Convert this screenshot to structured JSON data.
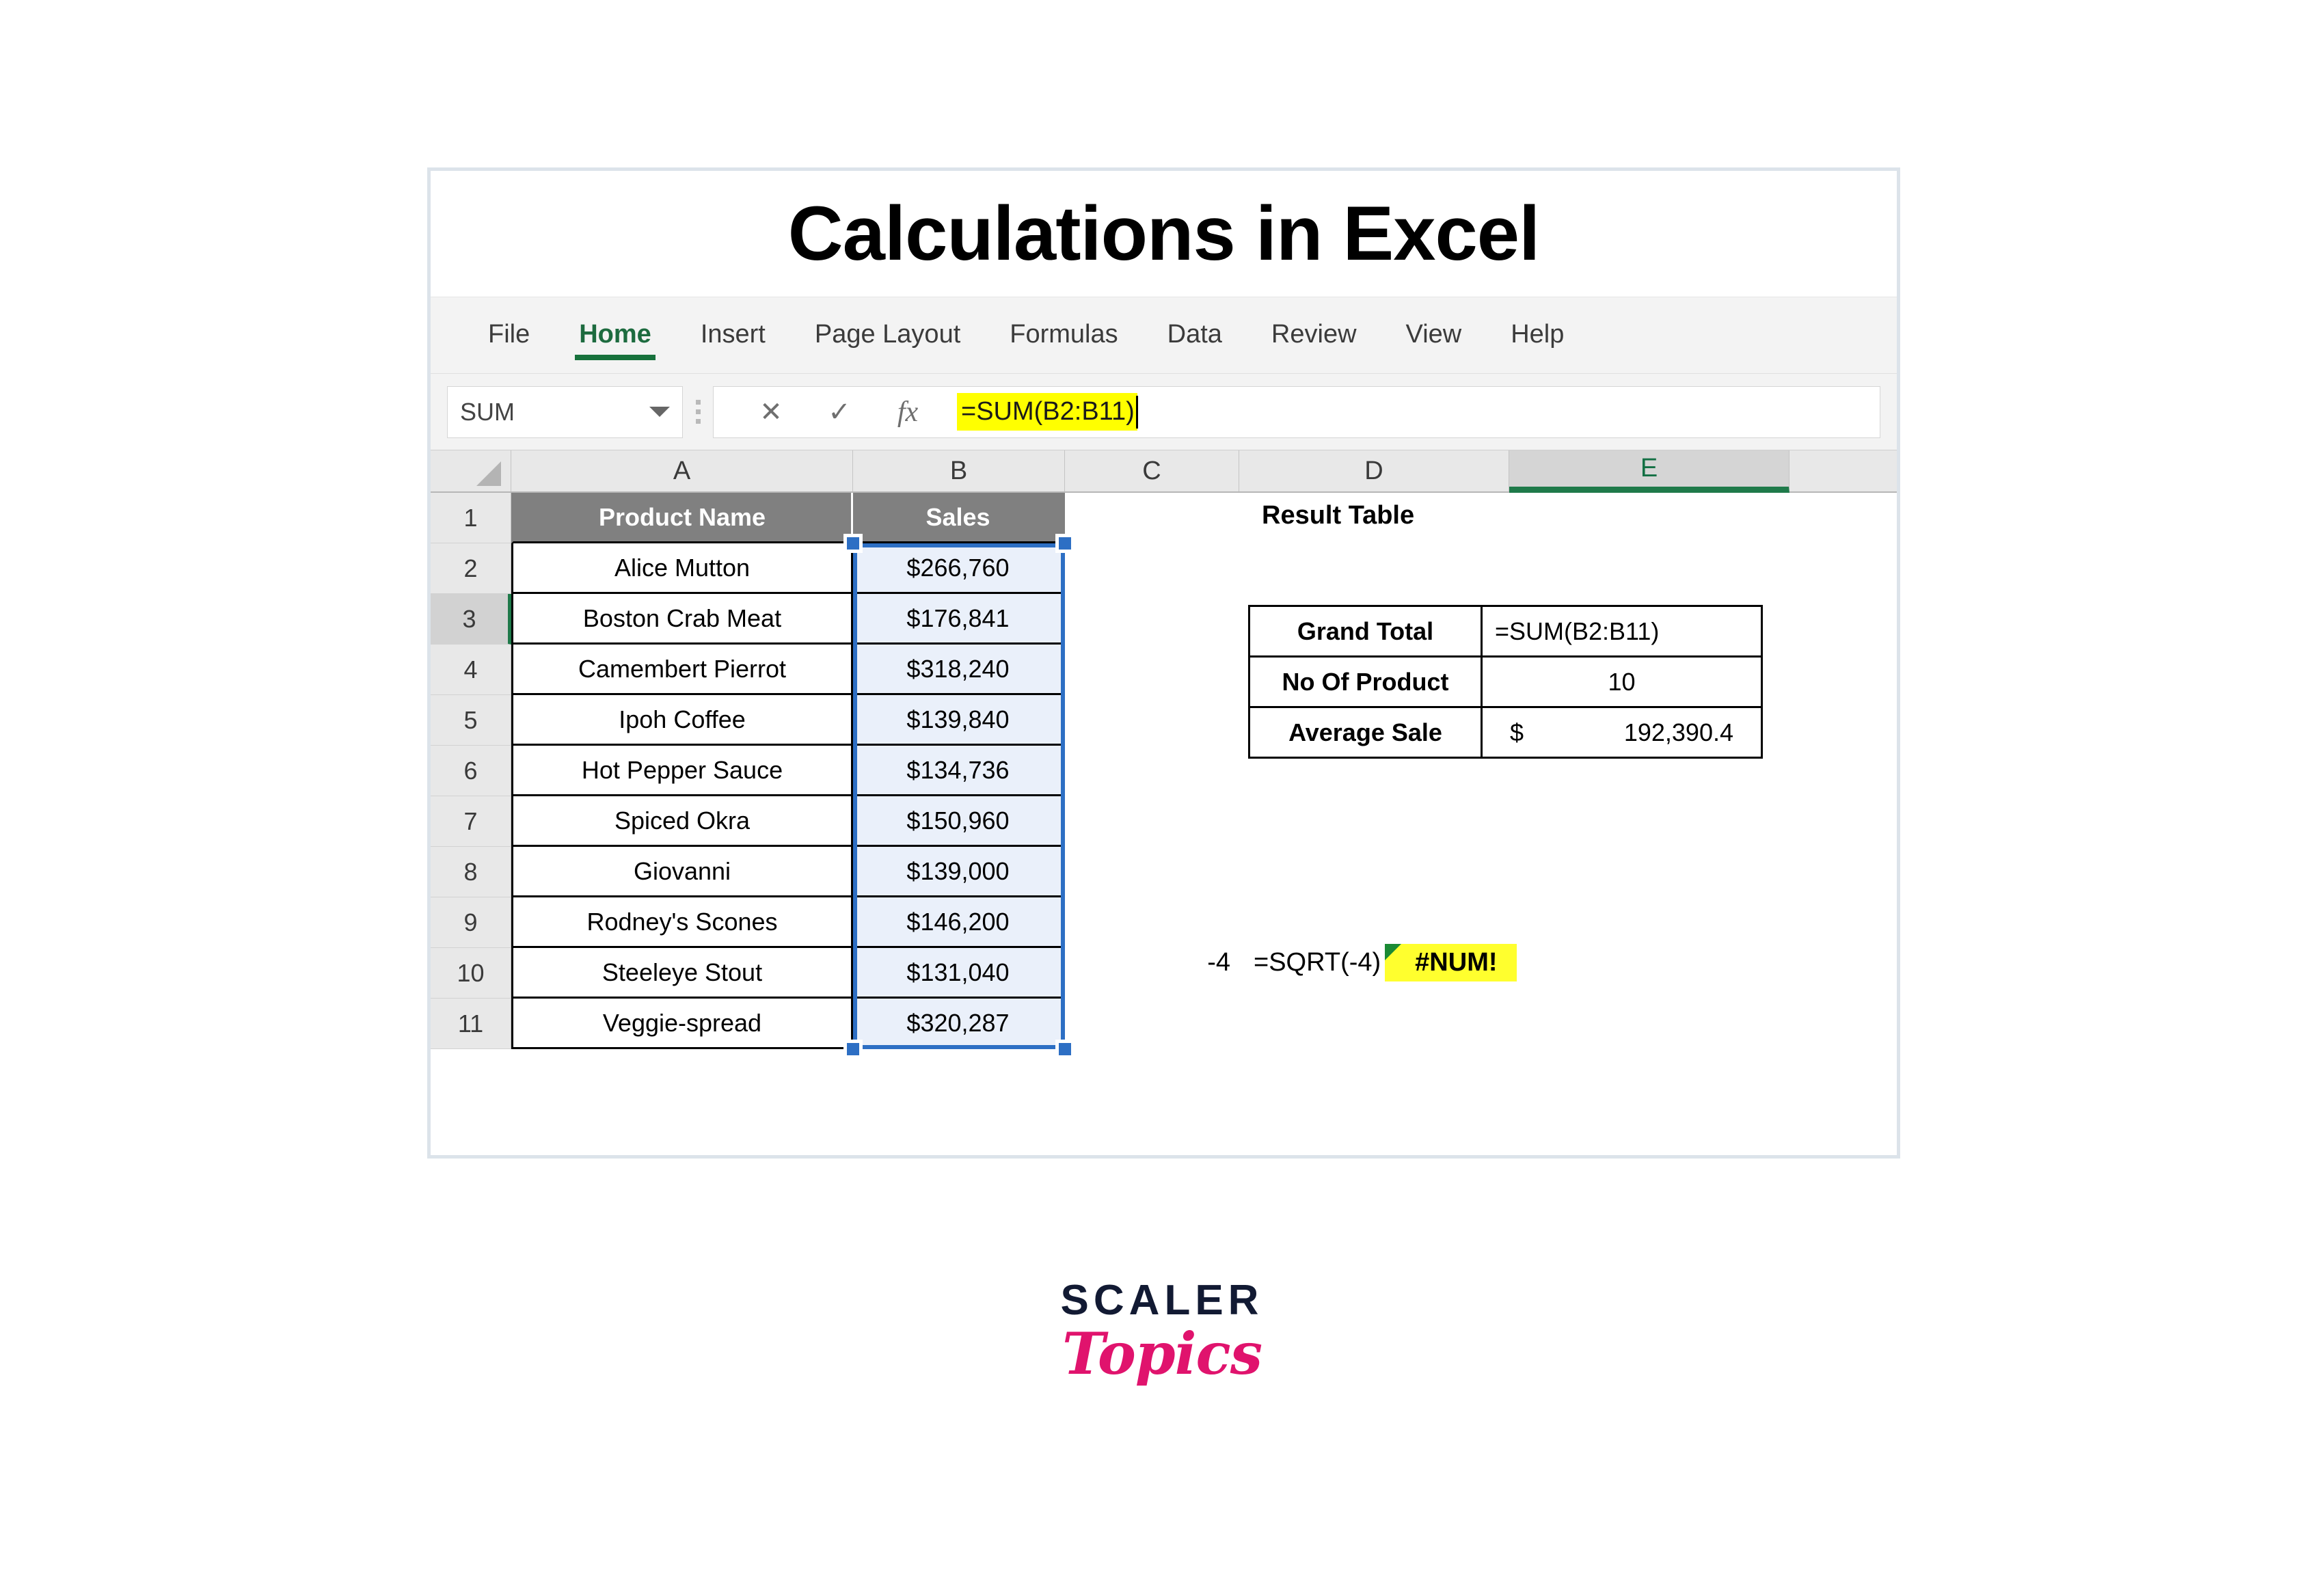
{
  "title": "Calculations in Excel",
  "ribbon": {
    "tabs": [
      {
        "label": "File",
        "active": false
      },
      {
        "label": "Home",
        "active": true
      },
      {
        "label": "Insert",
        "active": false
      },
      {
        "label": "Page Layout",
        "active": false
      },
      {
        "label": "Formulas",
        "active": false
      },
      {
        "label": "Data",
        "active": false
      },
      {
        "label": "Review",
        "active": false
      },
      {
        "label": "View",
        "active": false
      },
      {
        "label": "Help",
        "active": false
      }
    ]
  },
  "formula_bar": {
    "name_box_value": "SUM",
    "cancel_icon": "close-x-icon",
    "enter_icon": "check-icon",
    "function_icon": "fx-icon",
    "cancel_label": "✕",
    "enter_label": "✓",
    "function_label": "fx",
    "formula": "=SUM(B2:B11)",
    "highlight_color": "#ffff00"
  },
  "sheet": {
    "columns": [
      "A",
      "B",
      "C",
      "D",
      "E"
    ],
    "active_column": "E",
    "active_row": "3",
    "row_numbers": [
      "1",
      "2",
      "3",
      "4",
      "5",
      "6",
      "7",
      "8",
      "9",
      "10",
      "11"
    ],
    "header": {
      "product": "Product Name",
      "sales": "Sales"
    },
    "rows": [
      {
        "row": "2",
        "product": "Alice Mutton",
        "sales": "$266,760"
      },
      {
        "row": "3",
        "product": "Boston Crab Meat",
        "sales": "$176,841"
      },
      {
        "row": "4",
        "product": "Camembert Pierrot",
        "sales": "$318,240"
      },
      {
        "row": "5",
        "product": "Ipoh Coffee",
        "sales": "$139,840"
      },
      {
        "row": "6",
        "product": "Hot Pepper Sauce",
        "sales": "$134,736"
      },
      {
        "row": "7",
        "product": "Spiced Okra",
        "sales": "$150,960"
      },
      {
        "row": "8",
        "product": "Giovanni",
        "sales": "$139,000"
      },
      {
        "row": "9",
        "product": "Rodney's Scones",
        "sales": "$146,200"
      },
      {
        "row": "10",
        "product": "Steeleye Stout",
        "sales": "$131,040"
      },
      {
        "row": "11",
        "product": "Veggie-spread",
        "sales": "$320,287"
      }
    ],
    "selection_range": "B2:B11",
    "selection_color": "#2d6fc4"
  },
  "result_table": {
    "title": "Result Table",
    "rows": [
      {
        "label": "Grand Total",
        "value": "=SUM(B2:B11)",
        "highlight": "red-outline"
      },
      {
        "label": "No Of Product",
        "value": "10",
        "highlight": "none"
      },
      {
        "label": "Average Sale",
        "currency": "$",
        "value": "192,390.4",
        "highlight": "none"
      }
    ],
    "outline_color": "#ff0000"
  },
  "sqrt_demo": {
    "input": "-4",
    "formula": "=SQRT(-4)",
    "result": "#NUM!",
    "highlight_color": "#ffff2e",
    "error_flag_color": "#1a8a34"
  },
  "logo": {
    "primary": "SCALER",
    "secondary": "Topics",
    "primary_color": "#121a33",
    "secondary_color": "#e0136d"
  }
}
